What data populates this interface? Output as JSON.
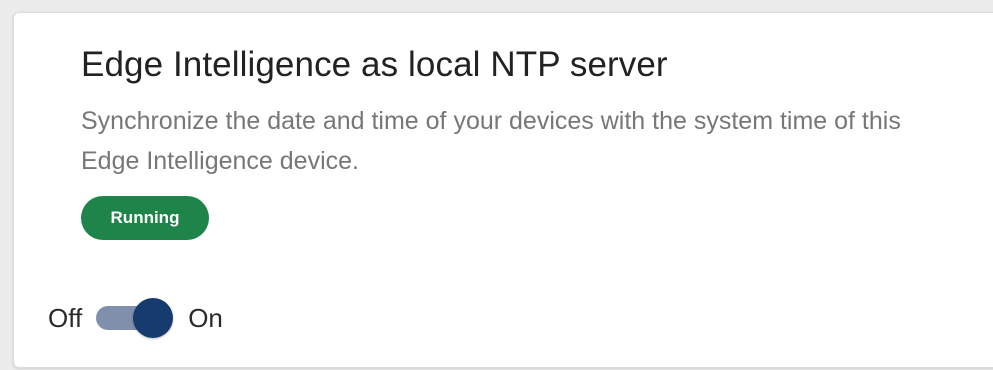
{
  "card": {
    "title": "Edge Intelligence as local NTP server",
    "description": "Synchronize the date and time of your devices with the system time of this Edge Intelligence device.",
    "status_badge": "Running"
  },
  "toggle": {
    "off_label": "Off",
    "on_label": "On",
    "state": "on"
  },
  "colors": {
    "status_running": "#1e8449",
    "toggle_thumb": "#163b6e",
    "toggle_track": "#7f8fac"
  }
}
